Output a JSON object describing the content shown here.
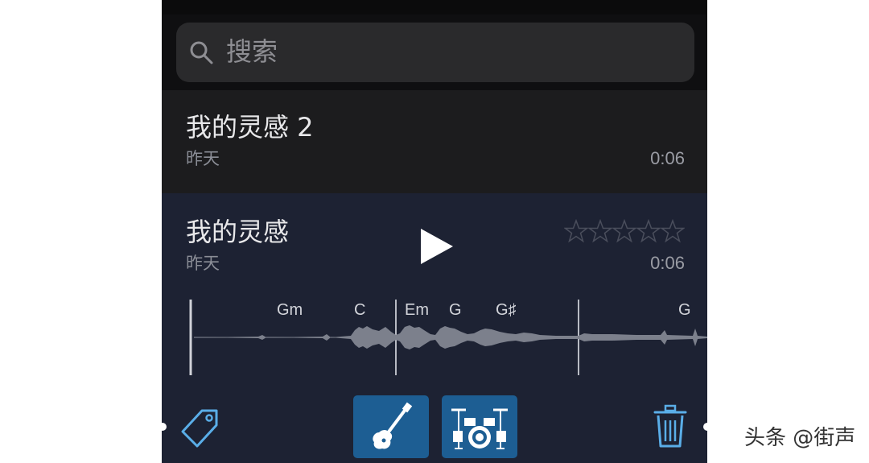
{
  "search": {
    "placeholder": "搜索",
    "icon": "search-icon"
  },
  "recordings": [
    {
      "title": "我的灵感 2",
      "date": "昨天",
      "duration": "0:06"
    },
    {
      "title": "我的灵感",
      "date": "昨天",
      "duration": "0:06",
      "rating_stars_filled": 0,
      "rating_stars_total": 5
    }
  ],
  "chords": [
    "Gm",
    "C",
    "Em",
    "G",
    "G♯",
    "G"
  ],
  "toolbar": {
    "tag_icon": "tag-icon",
    "guitar_icon": "electric-guitar-icon",
    "drums_icon": "drum-kit-icon",
    "trash_icon": "trash-icon"
  },
  "colors": {
    "accent": "#5aaee8",
    "selected_row_bg": "#1d2233",
    "tile_bg": "#1d5e93"
  },
  "watermark": "头条 @街声"
}
